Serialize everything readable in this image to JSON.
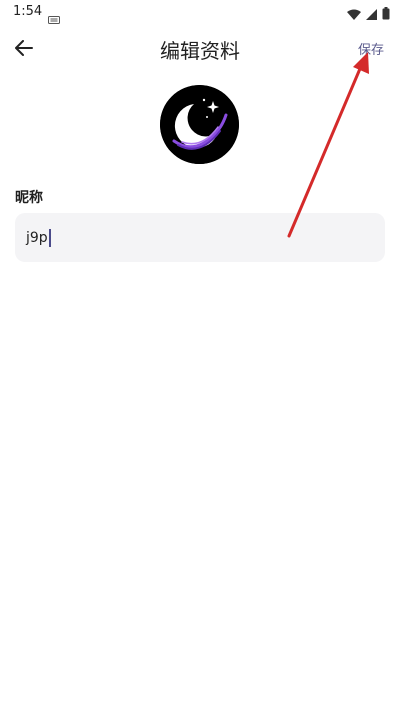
{
  "status_bar": {
    "time": "1:54"
  },
  "header": {
    "title": "编辑资料",
    "save_label": "保存"
  },
  "form": {
    "nickname_label": "昵称",
    "nickname_value": "j9p"
  },
  "colors": {
    "annotation_arrow": "#d42a2a",
    "save_text": "#5a5a8c",
    "field_bg": "#f4f4f6",
    "caret": "#4a4a8a"
  },
  "icons": {
    "back": "arrow-left-icon",
    "avatar": "moon-logo"
  }
}
